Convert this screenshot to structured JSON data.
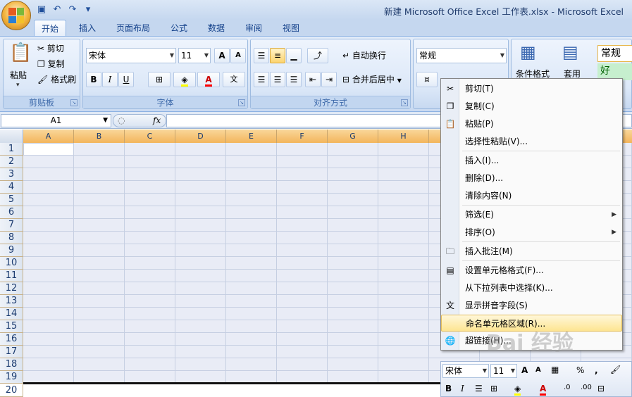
{
  "window": {
    "title": "新建 Microsoft Office Excel 工作表.xlsx - Microsoft Excel"
  },
  "tabs": [
    "开始",
    "插入",
    "页面布局",
    "公式",
    "数据",
    "审阅",
    "视图"
  ],
  "clipboard": {
    "paste": "粘贴",
    "cut": "剪切",
    "copy": "复制",
    "format_painter": "格式刷",
    "group": "剪贴板"
  },
  "font": {
    "name": "宋体",
    "size": "11",
    "bold": "B",
    "italic": "I",
    "underline": "U",
    "grow": "A",
    "shrink": "A",
    "group": "字体"
  },
  "alignment": {
    "wrap": "自动换行",
    "merge": "合并后居中",
    "group": "对齐方式"
  },
  "number": {
    "format": "常规"
  },
  "styles": {
    "cond_format": "条件格式",
    "table_format": "套用",
    "style_normal": "常规",
    "style_good": "好"
  },
  "namebox": "A1",
  "fx": "fx",
  "columns": [
    "A",
    "B",
    "C",
    "D",
    "E",
    "F",
    "G",
    "H"
  ],
  "rows": [
    "1",
    "2",
    "3",
    "4",
    "5",
    "6",
    "7",
    "8",
    "9",
    "10",
    "11",
    "12",
    "13",
    "14",
    "15",
    "16",
    "17",
    "18",
    "19",
    "20"
  ],
  "context_menu": {
    "items": [
      {
        "label": "剪切(T)",
        "icon": "scissors-icon"
      },
      {
        "label": "复制(C)",
        "icon": "copy-icon"
      },
      {
        "label": "粘贴(P)",
        "icon": "paste-icon"
      },
      {
        "label": "选择性粘贴(V)...",
        "icon": ""
      },
      {
        "label": "插入(I)...",
        "icon": ""
      },
      {
        "label": "删除(D)...",
        "icon": ""
      },
      {
        "label": "清除内容(N)",
        "icon": ""
      },
      {
        "label": "筛选(E)",
        "icon": "",
        "submenu": true
      },
      {
        "label": "排序(O)",
        "icon": "",
        "submenu": true
      },
      {
        "label": "插入批注(M)",
        "icon": "comment-icon"
      },
      {
        "label": "设置单元格格式(F)...",
        "icon": "format-cells-icon"
      },
      {
        "label": "从下拉列表中选择(K)...",
        "icon": ""
      },
      {
        "label": "显示拼音字段(S)",
        "icon": "phonetic-icon"
      },
      {
        "label": "命名单元格区域(R)...",
        "icon": "",
        "highlighted": true
      },
      {
        "label": "超链接(H)...",
        "icon": "hyperlink-icon"
      }
    ]
  },
  "mini_toolbar": {
    "font": "宋体",
    "size": "11",
    "percent": "%",
    "comma": ","
  },
  "watermark": "Bai 经验",
  "colors": {
    "ribbon": "#d6e3f5",
    "accent": "#15428b",
    "highlight": "#fde592"
  }
}
